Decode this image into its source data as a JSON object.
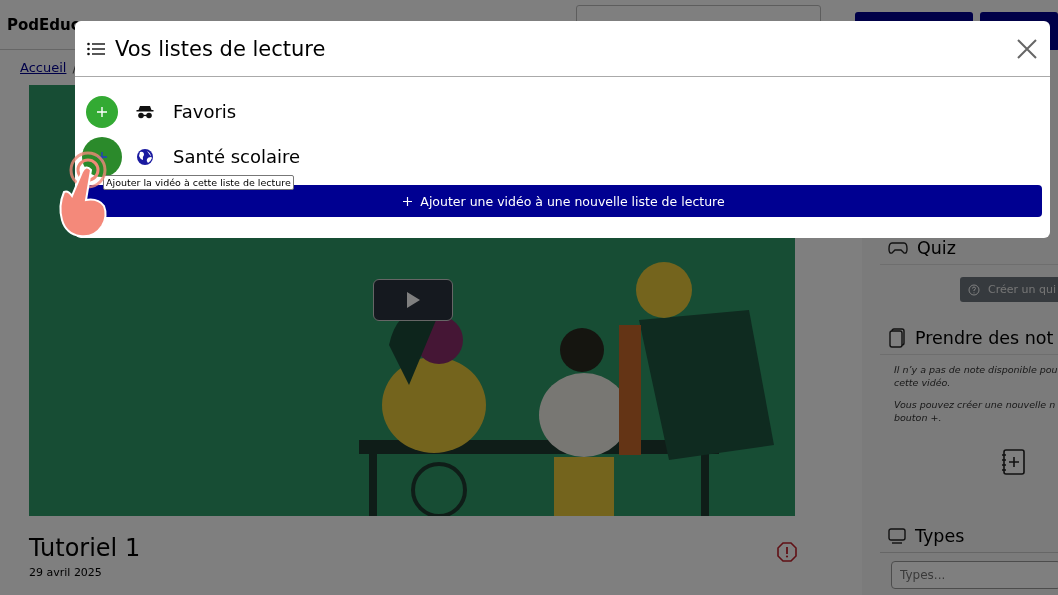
{
  "header": {
    "logo": "PodEduc"
  },
  "breadcrumb": {
    "items": [
      "Accueil"
    ],
    "separator": "/"
  },
  "video": {
    "title": "Tutoriel 1",
    "date": "29 avril 2025"
  },
  "sidebar": {
    "quiz": {
      "heading": "Quiz",
      "button": "Créer un qui"
    },
    "notes": {
      "heading": "Prendre des not",
      "paragraphs": [
        [
          "Il n’y a pas de note disponible pou",
          "cette vidéo."
        ],
        [
          "Vous pouvez créer une nouvelle n",
          "bouton +."
        ]
      ]
    },
    "types": {
      "heading": "Types",
      "placeholder": "Types..."
    }
  },
  "modal": {
    "title": "Vos listes de lecture",
    "playlists": [
      {
        "name": "Favoris",
        "kind": "private",
        "hovered": false
      },
      {
        "name": "Santé scolaire",
        "kind": "public",
        "hovered": true
      }
    ],
    "tooltip": "Ajouter la vidéo à cette liste de lecture",
    "new_button": "Ajouter une vidéo à une nouvelle liste de lecture"
  }
}
